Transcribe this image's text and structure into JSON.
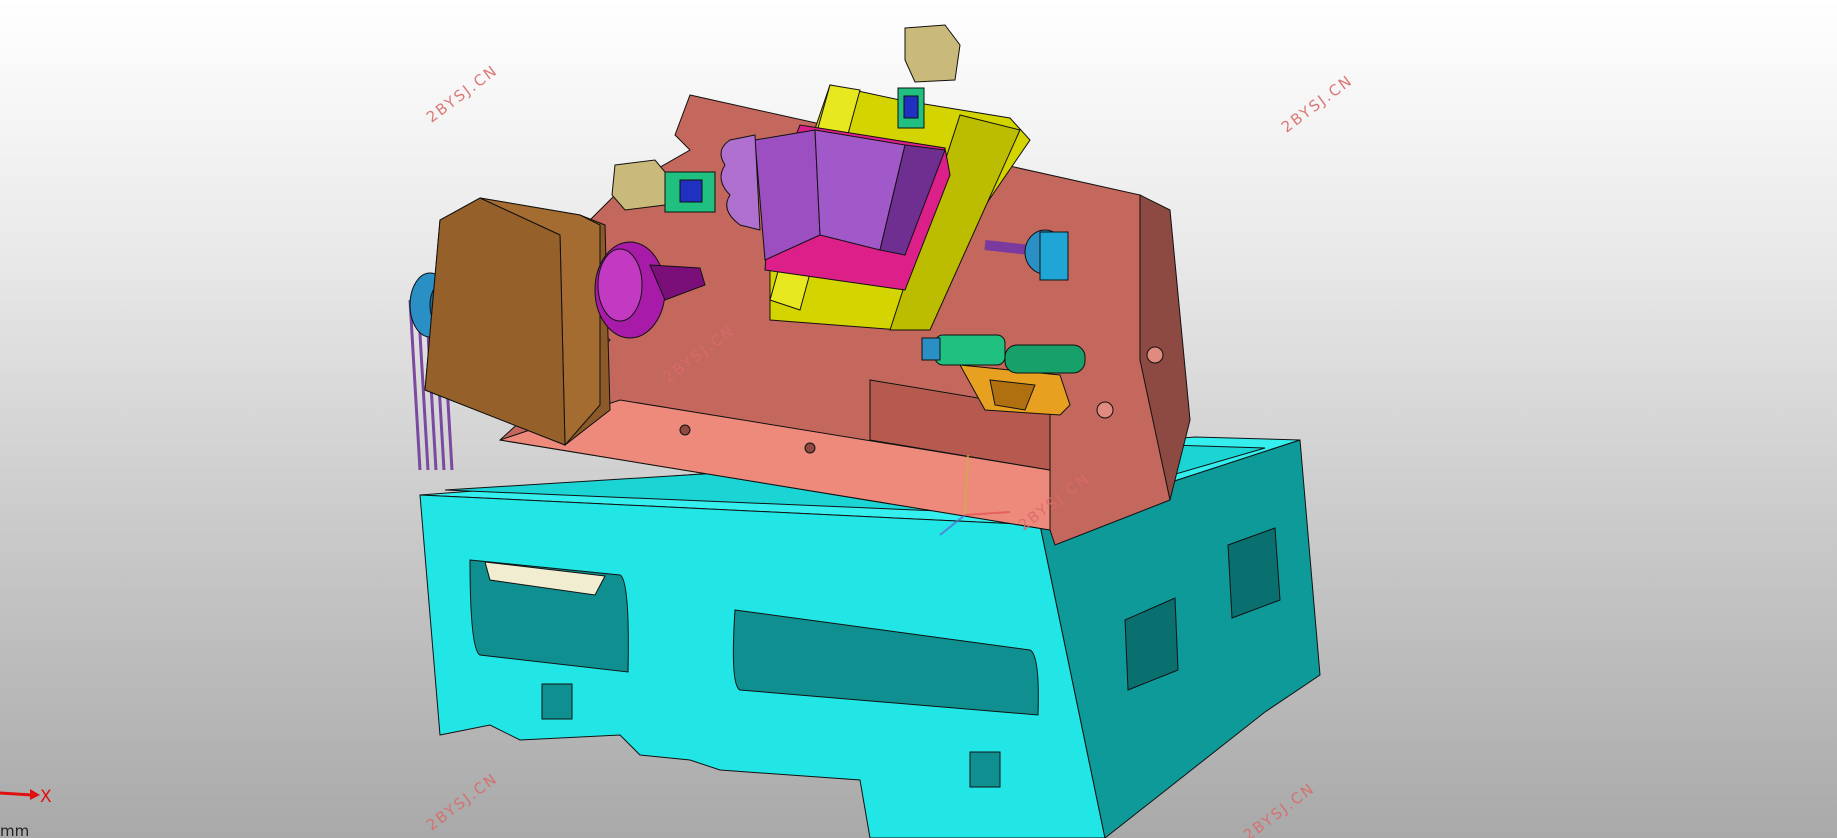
{
  "viewport": {
    "background_top": "#ffffff",
    "background_bottom": "#a9a9a9"
  },
  "watermarks": [
    "2BYSJ.CN",
    "2BYSJ.CN",
    "2BYSJ.CN",
    "2BYSJ.CN",
    "2BYSJ.CN",
    "2BYSJ.CN"
  ],
  "triad": {
    "x_label": "X"
  },
  "units": {
    "label": "mm"
  },
  "model": {
    "colors": {
      "base": "#22e6e6",
      "base_shade": "#119a9a",
      "bed": "#c4675c",
      "bed_shade": "#8c4a42",
      "headstock": "#8c5a28",
      "chuck": "#a81aa8",
      "carriage": "#d4d400",
      "turret": "#9b4fc0",
      "turret_base": "#dd1f8a",
      "motor": "#c9b97a",
      "tailstock": "#20c080",
      "pulley": "#2a8fc4",
      "belt": "#7a4aa0"
    }
  }
}
